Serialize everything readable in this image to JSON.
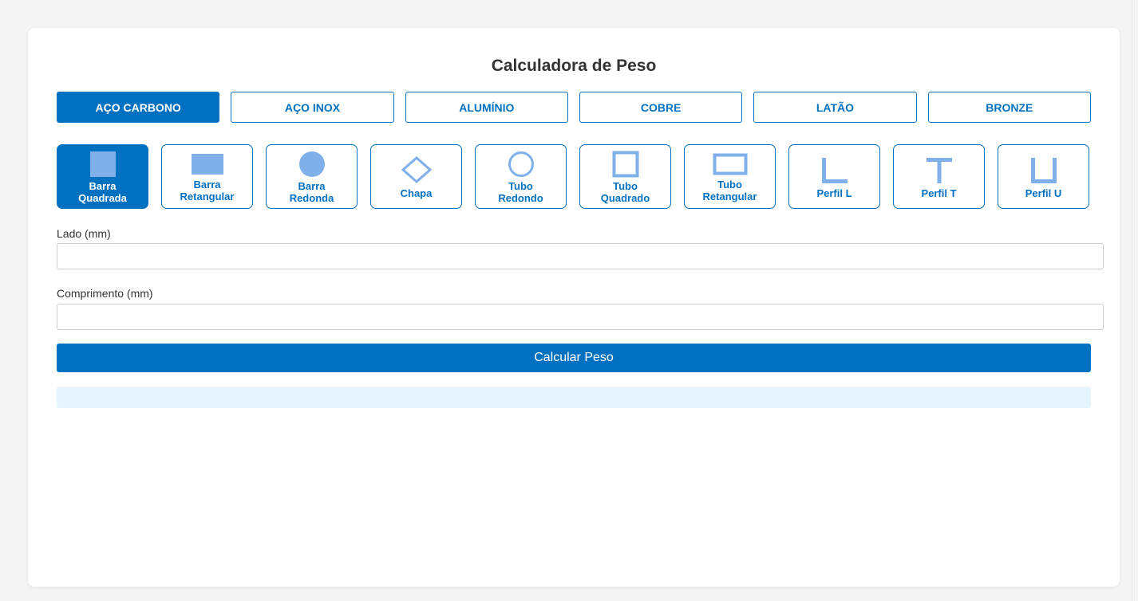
{
  "title": "Calculadora de Peso",
  "materials": [
    {
      "label": "AÇO CARBONO",
      "active": true
    },
    {
      "label": "AÇO INOX",
      "active": false
    },
    {
      "label": "ALUMÍNIO",
      "active": false
    },
    {
      "label": "COBRE",
      "active": false
    },
    {
      "label": "LATÃO",
      "active": false
    },
    {
      "label": "BRONZE",
      "active": false
    }
  ],
  "shapes": [
    {
      "label": "Barra\nQuadrada",
      "icon": "square-bar-icon",
      "active": true
    },
    {
      "label": "Barra\nRetangular",
      "icon": "rectangle-bar-icon",
      "active": false
    },
    {
      "label": "Barra\nRedonda",
      "icon": "round-bar-icon",
      "active": false
    },
    {
      "label": "Chapa",
      "icon": "sheet-icon",
      "active": false
    },
    {
      "label": "Tubo\nRedondo",
      "icon": "round-tube-icon",
      "active": false
    },
    {
      "label": "Tubo\nQuadrado",
      "icon": "square-tube-icon",
      "active": false
    },
    {
      "label": "Tubo\nRetangular",
      "icon": "rectangle-tube-icon",
      "active": false
    },
    {
      "label": "Perfil L",
      "icon": "l-profile-icon",
      "active": false
    },
    {
      "label": "Perfil T",
      "icon": "t-profile-icon",
      "active": false
    },
    {
      "label": "Perfil U",
      "icon": "u-profile-icon",
      "active": false
    }
  ],
  "form": {
    "side_label": "Lado (mm)",
    "side_value": "",
    "length_label": "Comprimento (mm)",
    "length_value": ""
  },
  "calculate_label": "Calcular Peso",
  "result_text": "",
  "colors": {
    "accent": "#0070c0",
    "icon_fill": "#7fb0ea",
    "result_bg": "#e6f5fd"
  }
}
